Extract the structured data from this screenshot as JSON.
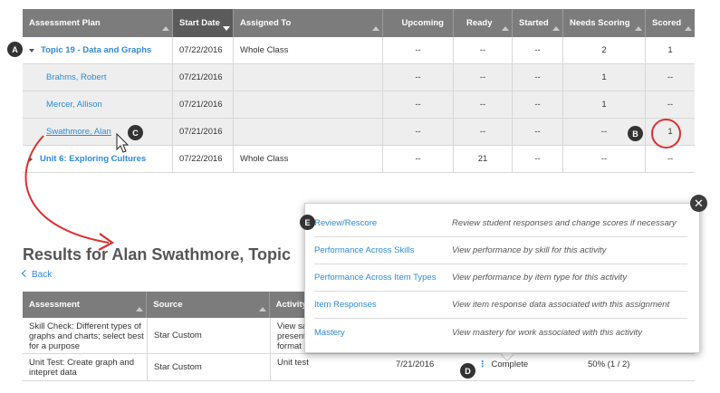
{
  "top_table": {
    "headers": [
      "Assessment Plan",
      "Start Date",
      "Assigned To",
      "Upcoming",
      "Ready",
      "Started",
      "Needs Scoring",
      "Scored"
    ],
    "rows": [
      {
        "plan": "Topic 19 - Data and Graphs",
        "start": "07/22/2016",
        "assigned": "Whole Class",
        "upcoming": "--",
        "ready": "--",
        "started": "--",
        "needs": "2",
        "scored": "1"
      },
      {
        "plan": "Brahms, Robert",
        "start": "07/21/2016",
        "assigned": "",
        "upcoming": "--",
        "ready": "--",
        "started": "--",
        "needs": "1",
        "scored": "--"
      },
      {
        "plan": "Mercer, Allison",
        "start": "07/21/2016",
        "assigned": "",
        "upcoming": "--",
        "ready": "--",
        "started": "--",
        "needs": "1",
        "scored": "--"
      },
      {
        "plan": "Swathmore, Alan",
        "start": "07/21/2016",
        "assigned": "",
        "upcoming": "--",
        "ready": "--",
        "started": "--",
        "needs": "--",
        "scored": "1"
      },
      {
        "plan": "Unit 6: Exploring Cultures",
        "start": "07/22/2016",
        "assigned": "Whole Class",
        "upcoming": "--",
        "ready": "21",
        "started": "--",
        "needs": "--",
        "scored": "--"
      }
    ]
  },
  "markers": {
    "a": "A",
    "b": "B",
    "c": "C",
    "d": "D",
    "e": "E"
  },
  "results_heading": "Results for Alan Swathmore, Topic",
  "back_label": "Back",
  "bottom_table": {
    "headers": [
      "Assessment",
      "Source",
      "Activity"
    ],
    "rows": [
      {
        "assessment": "Skill Check: Different types of graphs and charts; select best for a purpose",
        "source": "Star Custom",
        "activity": "View sa presenti format"
      },
      {
        "assessment": "Unit Test: Create graph and intepret data",
        "source": "Star Custom",
        "activity": "Unit test",
        "date": "7/21/2016",
        "status": "Complete",
        "score": "50% (1 / 2)"
      }
    ]
  },
  "popup": {
    "items": [
      {
        "label": "Review/Rescore",
        "desc": "Review student responses and change scores if necessary"
      },
      {
        "label": "Performance Across Skills",
        "desc": "View performance by skill for this activity"
      },
      {
        "label": "Performance Across Item Types",
        "desc": "View performance by item type for this activity"
      },
      {
        "label": "Item Responses",
        "desc": "View item response data associated with this assignment"
      },
      {
        "label": "Mastery",
        "desc": "View mastery for work associated with this activity"
      }
    ],
    "close_symbol": "✕"
  },
  "colors": {
    "header_bg": "#7c7c7c",
    "sorted_header_bg": "#5b5b5b",
    "link": "#2e8ad8",
    "annotation_red": "#d93030",
    "marker_bg": "#333333"
  },
  "icons": [
    "sort-triangle-icon",
    "expand-caret-icon",
    "collapse-caret-icon",
    "mouse-pointer-icon",
    "close-icon",
    "kebab-menu-icon",
    "back-chevron-icon"
  ]
}
